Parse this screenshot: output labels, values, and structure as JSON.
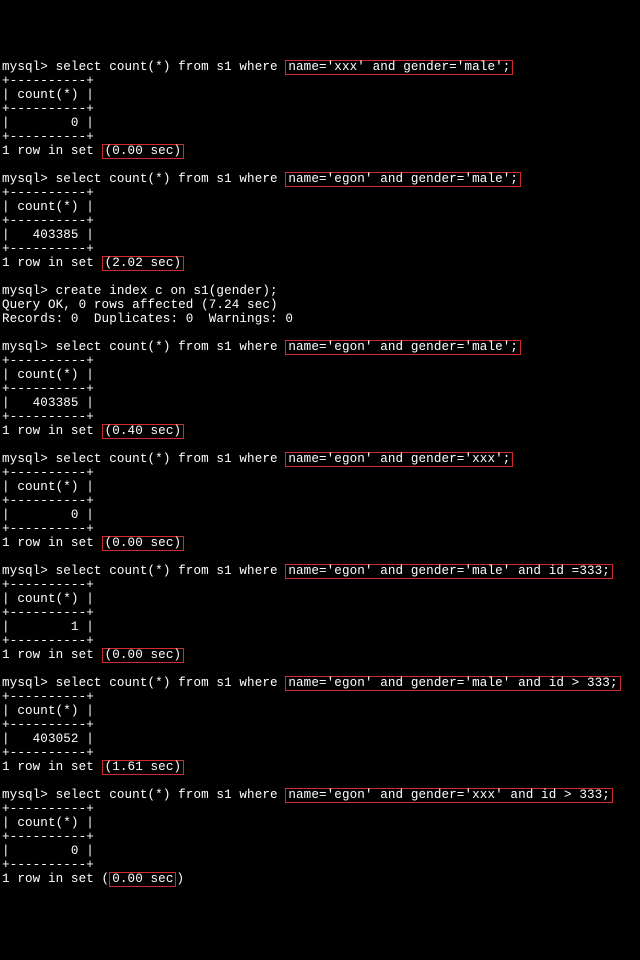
{
  "queries": [
    {
      "prompt": "mysql> ",
      "sql_pre": "select count(*) from s1 where ",
      "where": "name='xxx' and gender='male';",
      "where_boxed": true,
      "border": "+----------+",
      "header": "| count(*) |",
      "value": "|        0 |",
      "result_pre": "1 row in set ",
      "timing": "(0.00 sec)",
      "timing_boxed": true
    },
    {
      "prompt": "mysql> ",
      "sql_pre": "select count(*) from s1 where ",
      "where": "name='egon' and gender='male';",
      "where_boxed": true,
      "border": "+----------+",
      "header": "| count(*) |",
      "value": "|   403385 |",
      "result_pre": "1 row in set ",
      "timing": "(2.02 sec)",
      "timing_boxed": true
    }
  ],
  "intermezzo": [
    "mysql> create index c on s1(gender);",
    "Query OK, 0 rows affected (7.24 sec)",
    "Records: 0  Duplicates: 0  Warnings: 0",
    ""
  ],
  "queries2": [
    {
      "prompt": "mysql> ",
      "sql_pre": "select count(*) from s1 where ",
      "where": "name='egon' and gender='male';",
      "where_boxed": true,
      "border": "+----------+",
      "header": "| count(*) |",
      "value": "|   403385 |",
      "result_pre": "1 row in set ",
      "timing": "(0.40 sec)",
      "timing_boxed": true
    },
    {
      "prompt": "mysql> ",
      "sql_pre": "select count(*) from s1 where ",
      "where": "name='egon' and gender='xxx';",
      "where_boxed": true,
      "border": "+----------+",
      "header": "| count(*) |",
      "value": "|        0 |",
      "result_pre": "1 row in set ",
      "timing": "(0.00 sec)",
      "timing_boxed": true
    },
    {
      "prompt": "mysql> ",
      "sql_pre": "select count(*) from s1 where ",
      "where": "name='egon' and gender='male' and id =333;",
      "where_boxed": true,
      "border": "+----------+",
      "header": "| count(*) |",
      "value": "|        1 |",
      "result_pre": "1 row in set ",
      "timing": "(0.00 sec)",
      "timing_boxed": true
    },
    {
      "prompt": "mysql> ",
      "sql_pre": "select count(*) from s1 where ",
      "where": "name='egon' and gender='male' and id > 333;",
      "where_boxed": true,
      "border": "+----------+",
      "header": "| count(*) |",
      "value": "|   403052 |",
      "result_pre": "1 row in set ",
      "timing": "(1.61 sec)",
      "timing_boxed": true
    },
    {
      "prompt": "mysql> ",
      "sql_pre": "select count(*) from s1 where ",
      "where": "name='egon' and gender='xxx' and id > 333;",
      "where_boxed": true,
      "border": "+----------+",
      "header": "| count(*) |",
      "value": "|        0 |",
      "result_pre": "1 row in set (",
      "timing": "0.00 sec",
      "timing_boxed": true,
      "result_post": ")"
    }
  ]
}
